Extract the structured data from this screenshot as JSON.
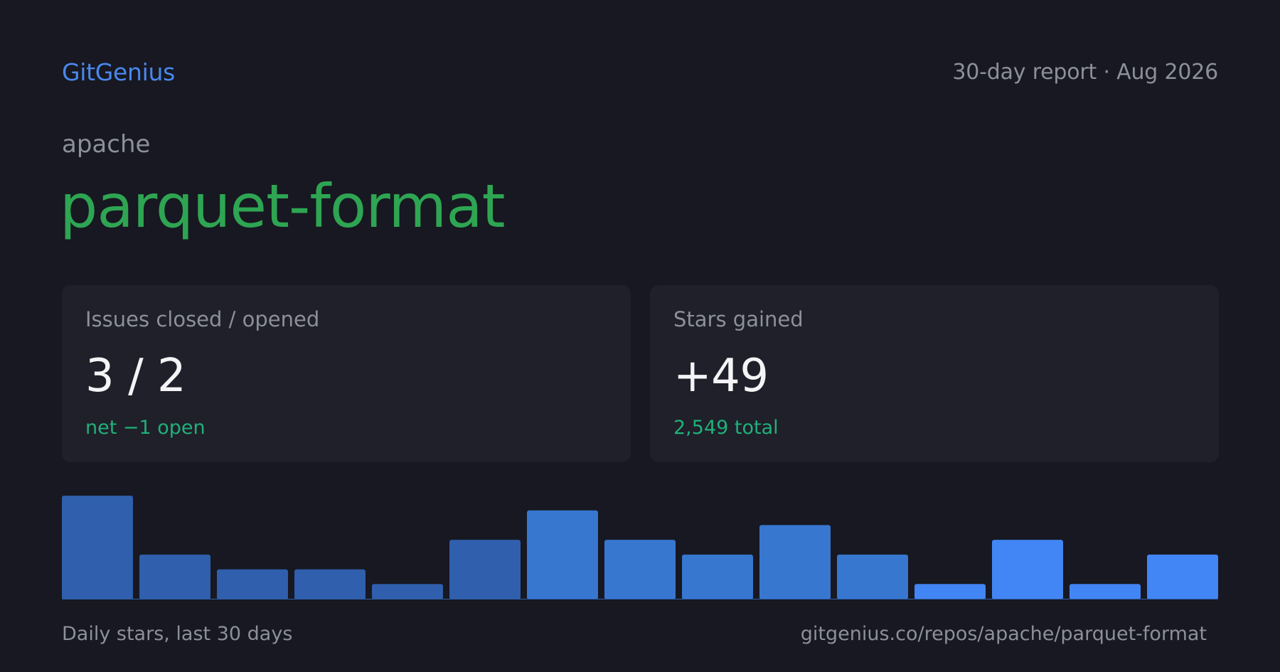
{
  "header": {
    "brand": "GitGenius",
    "report_label": "30-day report · Aug 2026"
  },
  "repo": {
    "owner": "apache",
    "name": "parquet-format"
  },
  "cards": {
    "issues": {
      "label": "Issues closed / opened",
      "value": "3 / 2",
      "sub": "net −1 open"
    },
    "stars": {
      "label": "Stars gained",
      "value": "+49",
      "sub": "2,549 total"
    }
  },
  "footer": {
    "caption": "Daily stars, last 30 days",
    "url": "gitgenius.co/repos/apache/parquet-format"
  },
  "colors": {
    "background": "#171821",
    "card": "#1f2029",
    "brand": "#4a88ec",
    "repo_name": "#2ea552",
    "positive": "#20b07a",
    "bar_old": "#2f5fad",
    "bar_mid": "#3777d0",
    "bar_new": "#4285f4"
  },
  "chart_data": {
    "type": "bar",
    "values": [
      7,
      3,
      2,
      2,
      1,
      4,
      6,
      4,
      3,
      5,
      3,
      1,
      4,
      1,
      3
    ],
    "ylim": [
      0,
      7
    ],
    "grid": false,
    "legend": "none"
  }
}
